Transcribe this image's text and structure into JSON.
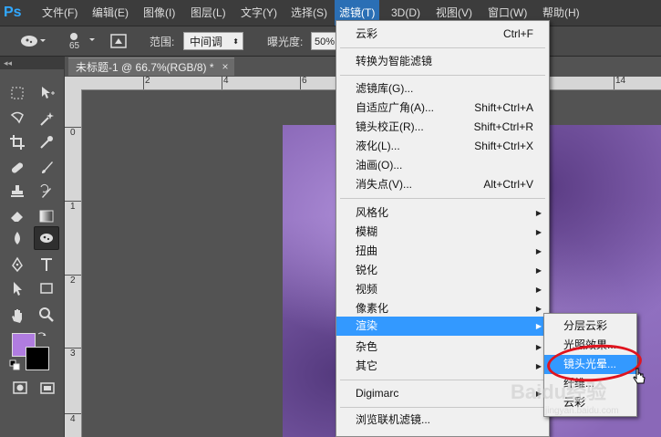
{
  "app": {
    "logo": "Ps"
  },
  "menubar": {
    "items": [
      "文件(F)",
      "编辑(E)",
      "图像(I)",
      "图层(L)",
      "文字(Y)",
      "选择(S)",
      "滤镜(T)",
      "3D(D)",
      "视图(V)",
      "窗口(W)",
      "帮助(H)"
    ],
    "active": "滤镜(T)"
  },
  "options_bar": {
    "brush_size": "65",
    "range_label": "范围:",
    "range_value": "中间调",
    "exposure_label": "曝光度:",
    "exposure_value": "50%"
  },
  "toolbox": {
    "collapse_glyph": "◂◂",
    "tools": [
      "marquee-icon",
      "move-icon",
      "lasso-icon",
      "magic-wand-icon",
      "crop-icon",
      "eyedropper-icon",
      "healing-brush-icon",
      "brush-icon",
      "clone-stamp-icon",
      "history-brush-icon",
      "eraser-icon",
      "gradient-icon",
      "blur-icon",
      "sponge-icon",
      "pen-icon",
      "type-icon",
      "path-selection-icon",
      "rectangle-icon",
      "hand-icon",
      "zoom-icon"
    ],
    "selected_tool": "sponge-icon",
    "foreground_color": "#b07ce0",
    "background_color": "#000000"
  },
  "document": {
    "tab_title": "未标题-1 @ 66.7%(RGB/8) *",
    "close_glyph": "×",
    "ruler_top_numbers": [
      "2",
      "4",
      "6",
      "8",
      "10",
      "12",
      "14"
    ],
    "ruler_left_numbers": [
      "0",
      "1",
      "2",
      "3",
      "4"
    ]
  },
  "filter_menu": {
    "items": [
      {
        "label": "云彩",
        "shortcut": "Ctrl+F"
      },
      {
        "label": "转换为智能滤镜"
      },
      {
        "label": "滤镜库(G)..."
      },
      {
        "label": "自适应广角(A)...",
        "shortcut": "Shift+Ctrl+A"
      },
      {
        "label": "镜头校正(R)...",
        "shortcut": "Shift+Ctrl+R"
      },
      {
        "label": "液化(L)...",
        "shortcut": "Shift+Ctrl+X"
      },
      {
        "label": "油画(O)..."
      },
      {
        "label": "消失点(V)...",
        "shortcut": "Alt+Ctrl+V"
      },
      {
        "label": "风格化",
        "submenu": true
      },
      {
        "label": "模糊",
        "submenu": true
      },
      {
        "label": "扭曲",
        "submenu": true
      },
      {
        "label": "锐化",
        "submenu": true
      },
      {
        "label": "视频",
        "submenu": true
      },
      {
        "label": "像素化",
        "submenu": true
      },
      {
        "label": "渲染",
        "submenu": true,
        "highlighted": true
      },
      {
        "label": "杂色",
        "submenu": true
      },
      {
        "label": "其它",
        "submenu": true
      },
      {
        "label": "Digimarc",
        "submenu": true
      },
      {
        "label": "浏览联机滤镜..."
      }
    ],
    "arrow_glyph": "▶"
  },
  "render_submenu": {
    "items": [
      "分层云彩",
      "光照效果...",
      "镜头光晕...",
      "纤维...",
      "云彩"
    ],
    "highlighted": "镜头光晕..."
  },
  "watermark": {
    "text": "Baidu经验",
    "url": "jingyan.baidu.com"
  },
  "colors": {
    "accent": "#3399ff",
    "annotation": "#e0141e"
  }
}
